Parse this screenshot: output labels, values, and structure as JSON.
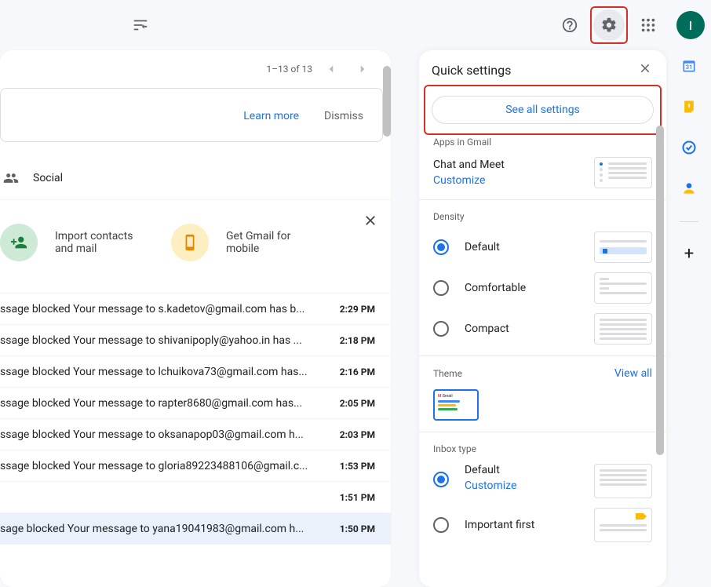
{
  "topbar": {
    "avatar_initial": "I"
  },
  "pager": {
    "range": "1–13 of 13"
  },
  "teaser": {
    "learn_more": "Learn more",
    "dismiss": "Dismiss"
  },
  "tabs": {
    "social": "Social"
  },
  "getting_started": {
    "import": "Import contacts and mail",
    "mobile": "Get Gmail for mobile"
  },
  "emails": [
    {
      "subject": "ssage blocked Your message to s.kadetov@gmail.com has b...",
      "time": "2:29 PM"
    },
    {
      "subject": "ssage blocked Your message to shivanipoply@yahoo.in has ...",
      "time": "2:18 PM"
    },
    {
      "subject": "ssage blocked Your message to lchuikova73@gmail.com has...",
      "time": "2:16 PM"
    },
    {
      "subject": "ssage blocked Your message to rapter8680@gmail.com has...",
      "time": "2:05 PM"
    },
    {
      "subject": "ssage blocked Your message to oksanapop03@gmail.com h...",
      "time": "2:03 PM"
    },
    {
      "subject": "ssage blocked Your message to gloria89223488106@gmail.c...",
      "time": "1:53 PM"
    },
    {
      "subject": "",
      "time": "1:51 PM"
    },
    {
      "subject": "sage blocked Your message to yana19041983@gmail.com h...",
      "time": "1:50 PM"
    }
  ],
  "qs": {
    "title": "Quick settings",
    "see_all": "See all settings",
    "apps_heading": "Apps in Gmail",
    "chat_meet": "Chat and Meet",
    "customize": "Customize",
    "density_heading": "Density",
    "density_default": "Default",
    "density_comfortable": "Comfortable",
    "density_compact": "Compact",
    "theme_heading": "Theme",
    "view_all": "View all",
    "inbox_heading": "Inbox type",
    "inbox_default": "Default",
    "inbox_customize": "Customize",
    "inbox_important": "Important first"
  },
  "rail": {
    "calendar_day": "31"
  }
}
